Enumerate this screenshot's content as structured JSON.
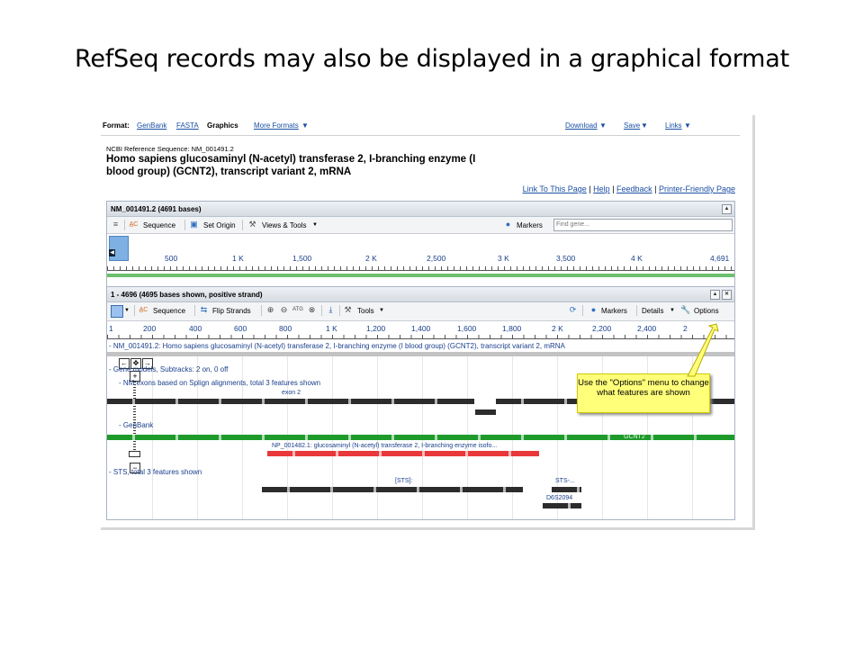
{
  "slide": {
    "title": "RefSeq records may also be displayed in a graphical format"
  },
  "format_bar": {
    "format_label": "Format:",
    "genbank": "GenBank",
    "fasta": "FASTA",
    "graphics": "Graphics",
    "more_formats": "More Formats",
    "download": "Download",
    "save": "Save",
    "links": "Links"
  },
  "record": {
    "refseq_line": "NCBI Reference Sequence: NM_001491.2",
    "title_line1": "Homo sapiens glucosaminyl (N-acetyl) transferase 2, I-branching enzyme (I",
    "title_line2": "blood group) (GCNT2), transcript variant 2, mRNA"
  },
  "page_links": {
    "link_to_page": "Link To This Page",
    "help": "Help",
    "feedback": "Feedback",
    "printer_friendly": "Printer-Friendly Page",
    "sep": "|"
  },
  "panel1": {
    "header": "NM_001491.2 (4691 bases)",
    "toolbar": {
      "sequence": "Sequence",
      "set_origin": "Set Origin",
      "views_tools": "Views & Tools",
      "markers": "Markers",
      "find_placeholder": "Find gene..."
    },
    "ruler": [
      "500",
      "1 K",
      "1,500",
      "2 K",
      "2,500",
      "3 K",
      "3,500",
      "4 K",
      "4,691"
    ]
  },
  "panel2": {
    "header": "1 - 4696 (4695 bases shown, positive strand)",
    "toolbar": {
      "sequence": "Sequence",
      "flip_strands": "Flip Strands",
      "tools": "Tools",
      "markers": "Markers",
      "details": "Details",
      "options": "Options"
    },
    "ruler": [
      "1",
      "200",
      "400",
      "600",
      "800",
      "1 K",
      "1,200",
      "1,400",
      "1,600",
      "1,800",
      "2 K",
      "2,200",
      "2,400",
      "2"
    ],
    "tracks": {
      "nm_line": "- NM_001491.2: Homo sapiens glucosaminyl (N-acetyl) transferase 2, I-branching enzyme (I blood group) (GCNT2), transcript variant 2, mRNA",
      "gene_models": "- Gene models, Subtracks: 2 on, 0 off",
      "exons": "- NM exons based on Splign alignments, total 3 features shown",
      "exon2": "exon 2",
      "genbank": "- GenBank",
      "gcnt2": "GCNT2",
      "np_label": "NP_001482.1: glucosaminyl (N-acetyl) transferase 2, I-branching enzyme isofo...",
      "sts": "- STS, total 3 features shown",
      "sts_feat": "[STS]:",
      "sts_short": "STS-...",
      "d6s": "D6S2094"
    }
  },
  "callout": {
    "text": "Use the \"Options\" menu to change what features are shown"
  },
  "colors": {
    "link": "#1b4fa5",
    "green_track": "#1e9a2a",
    "red_track": "#e8383a",
    "callout_bg": "#ffff7a"
  }
}
